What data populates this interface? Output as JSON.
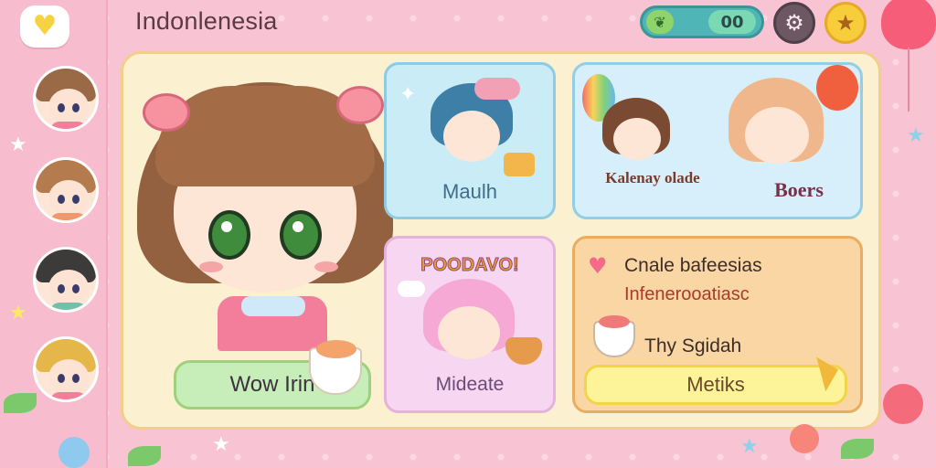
{
  "header": {
    "title": "Indonlenesia",
    "currency_count": "00",
    "currency_icon": "leaf-icon",
    "settings_icon": "settings-icon",
    "star_icon": "star-icon"
  },
  "sidebar": {
    "avatars": [
      {
        "hair": "#9a6a47",
        "body": "#f27e9b"
      },
      {
        "hair": "#b47c4e",
        "body": "#f0976c"
      },
      {
        "hair": "#3d3a3a",
        "body": "#6fc1a9"
      },
      {
        "hair": "#e5b64a",
        "body": "#f27e9b"
      }
    ]
  },
  "hero": {
    "button_label": "Wow Irin"
  },
  "cards": {
    "maulh_label": "Maulh",
    "party_label_a": "Kalenay olade",
    "party_label_b": "Boers",
    "pink_top_label": "POODAVO!",
    "pink_label": "Mideate"
  },
  "info": {
    "line1": "Cnale bafeesias",
    "line2": "Infenerooatiasc",
    "line3": "Thy Sgidah",
    "button_label": "Metiks"
  },
  "colors": {
    "background": "#f8c3d3",
    "panel": "#fbf0cf",
    "accent_green": "#c7eeb9",
    "accent_yellow": "#fdf49a"
  }
}
